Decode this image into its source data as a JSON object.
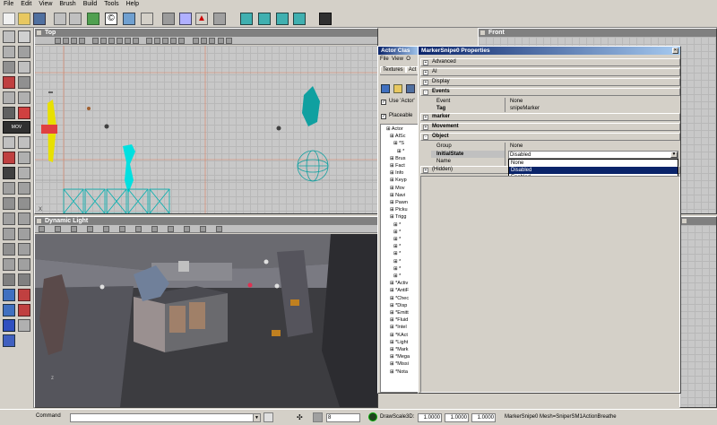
{
  "menubar": {
    "items": [
      "File",
      "Edit",
      "View",
      "Brush",
      "Build",
      "Tools",
      "Help"
    ]
  },
  "viewports": {
    "top": {
      "title": "Top"
    },
    "front": {
      "title": "Front"
    },
    "dynamic": {
      "title": "Dynamic Light"
    }
  },
  "actor_browser": {
    "title": "Actor Clas",
    "menu": [
      "File",
      "View",
      "O"
    ],
    "tabs": [
      "Textures",
      "Act"
    ],
    "use_actor": "Use 'Actor'",
    "placeable": "Placeable",
    "tree": [
      "Actor",
      "AISc",
      "*S",
      "*",
      "Brus",
      "Fact",
      "Info",
      "Keyp",
      "Mov",
      "Navi",
      "Pawn",
      "Picku",
      "Trigg",
      "*",
      "*",
      "*",
      "*",
      "*",
      "*",
      "*",
      "*",
      "*Activ",
      "*AntiF",
      "*Chec",
      "*Disp",
      "*Emitt",
      "*Fluid",
      "*Intel",
      "*KAct",
      "*Light",
      "*Mark",
      "*Mega",
      "*Missi",
      "*Nota"
    ]
  },
  "properties": {
    "title": "MarkerSnipe0 Properties",
    "rows": [
      {
        "label": "Advanced",
        "sign": "+",
        "bold": false
      },
      {
        "label": "AI",
        "sign": "+",
        "bold": false
      },
      {
        "label": "Display",
        "sign": "+",
        "bold": false
      },
      {
        "label": "Events",
        "sign": "-",
        "bold": true
      },
      {
        "label": "marker",
        "sign": "+",
        "bold": true
      },
      {
        "label": "Movement",
        "sign": "+",
        "bold": true
      },
      {
        "label": "Object",
        "sign": "-",
        "bold": true
      },
      {
        "label": "(Hidden)",
        "sign": "+",
        "bold": false
      }
    ],
    "event_key": "Event",
    "event_value": "None",
    "tag_key": "Tag",
    "tag_value": "snipeMarker",
    "group_key": "Group",
    "group_value": "None",
    "initialstate_key": "InitialState",
    "initialstate_value": "Disabled",
    "name_key": "Name",
    "dropdown_options": [
      "None",
      "Disabled",
      "Enabled"
    ],
    "dropdown_selected": "Disabled"
  },
  "statusbar": {
    "command_label": "Command",
    "grid_value": "8",
    "drawscale_label": "DrawScale3D:",
    "scale_x": "1.0000",
    "scale_y": "1.0000",
    "scale_z": "1.0000",
    "status_text": "MarkerSnipe0 Mesh=SniperSM1ActionBreathe"
  },
  "colors": {
    "title_blue": "#0a246a",
    "selection": "#0a246a",
    "cyan": "#00c8c8",
    "yellow": "#e8e000"
  }
}
